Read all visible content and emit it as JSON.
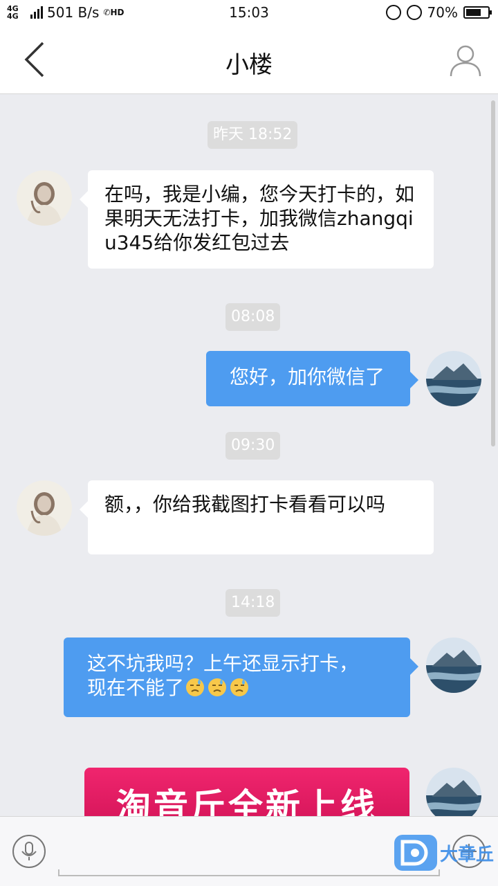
{
  "status_bar": {
    "network": "4G 4G",
    "speed": "501 B/s",
    "hd": "HD",
    "time": "15:03",
    "battery": "70%",
    "battery_level": 0.7
  },
  "nav": {
    "title": "小楼"
  },
  "messages": {
    "ts1": "昨天 18:52",
    "msg1": "在吗，我是小编，您今天打卡的，如果明天无法打卡，加我微信zhangqiu345给你发红包过去",
    "ts2": "08:08",
    "msg2": "您好，加你微信了",
    "ts3": "09:30",
    "msg3": "额，，你给我截图打卡看看可以吗",
    "ts4": "14:18",
    "msg4_line1": "这不坑我吗？上午还显示打卡，",
    "msg4_line2": "现在不能了",
    "msg4_emoji": "downcast-sweat-face",
    "promo_text": "淘音斤全新上线"
  },
  "input": {
    "watermark": "大章丘"
  },
  "colors": {
    "outgoing_bubble": "#4e9cf0",
    "background": "#ebecf0",
    "promo": "#e81f66"
  }
}
